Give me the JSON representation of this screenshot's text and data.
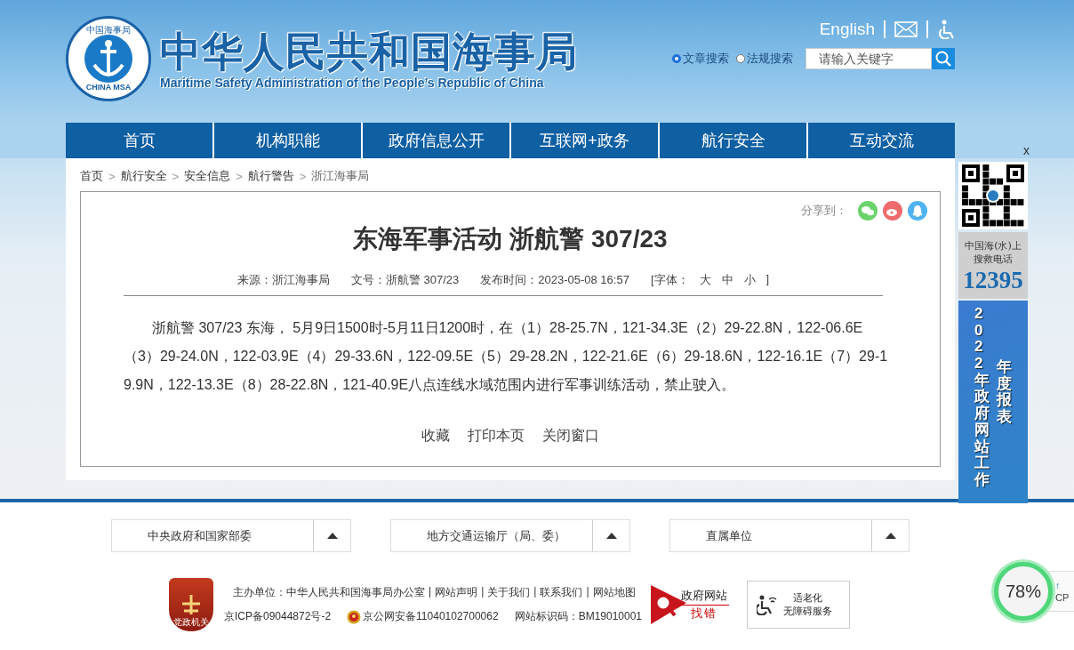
{
  "header": {
    "logo": {
      "ring_top": "中国海事局",
      "ring_bottom": "CHINA MSA"
    },
    "title": "中华人民共和国海事局",
    "subtitle": "Maritime Safety Administration of the People’s Republic of China",
    "english_link": "English",
    "search_options": [
      {
        "label": "文章搜索",
        "selected": true
      },
      {
        "label": "法规搜索",
        "selected": false
      }
    ],
    "search": {
      "placeholder": "请输入关键字"
    }
  },
  "nav": [
    "首页",
    "机构职能",
    "政府信息公开",
    "互联网+政务",
    "航行安全",
    "互动交流"
  ],
  "breadcrumb": [
    {
      "label": "首页"
    },
    {
      "separator": ">",
      "label": "航行安全"
    },
    {
      "separator": ">",
      "label": "安全信息"
    },
    {
      "separator": ">",
      "label": "航行警告"
    },
    {
      "separator": ">",
      "label": "浙江海事局"
    }
  ],
  "article": {
    "share_label": "分享到：",
    "title": "东海军事活动 浙航警 307/23",
    "meta": {
      "source": "来源：浙江海事局",
      "doc_no": "文号：浙航警 307/23",
      "published": "发布时间：2023-05-08 16:57",
      "font_label": "[字体：",
      "font_sizes": [
        "大",
        "中",
        "小"
      ],
      "font_end": "]"
    },
    "body": "浙航警 307/23 东海， 5月9日1500时-5月11日1200时，在（1）28-25.7N，121-34.3E（2）29-22.8N，122-06.6E（3）29-24.0N，122-03.9E（4）29-33.6N，122-09.5E（5）29-28.2N，122-21.6E（6）29-18.6N，122-16.1E（7）29-19.9N，122-13.3E（8）28-22.8N，121-40.9E八点连线水域范围内进行军事训练活动，禁止驶入。",
    "actions": [
      "收藏",
      "打印本页",
      "关闭窗口"
    ]
  },
  "sidebar": {
    "close": "x",
    "hotline": {
      "line_1": "中国海(水)上",
      "line_2": "搜救电话",
      "number": "12395"
    },
    "banner": {
      "column_1": "2022年政府网站工作",
      "column_2": "年度报表"
    }
  },
  "footer": {
    "dropdowns": [
      "中央政府和国家部委",
      "地方交通运输厅（局、委）",
      "直属单位"
    ],
    "badge": "党政机关",
    "host": "主办单位：中华人民共和国海事局办公室",
    "links": [
      {
        "separator": "|",
        "label": "网站声明"
      },
      {
        "separator": "|",
        "label": "关于我们"
      },
      {
        "separator": "|",
        "label": "联系我们"
      },
      {
        "separator": "|",
        "label": "网站地图"
      }
    ],
    "icp": "京ICP备09044872号-2",
    "police": "京公网安备11040102700062",
    "site_id": "网站标识码：BM19010001",
    "error_report": {
      "line_1": "政府网站",
      "line_2": "找错"
    },
    "elder": {
      "line_1": "适老化",
      "line_2": "无障碍服务"
    }
  },
  "cpu_widget": {
    "percent": "78%",
    "arrow": "↑",
    "label": "CP"
  }
}
